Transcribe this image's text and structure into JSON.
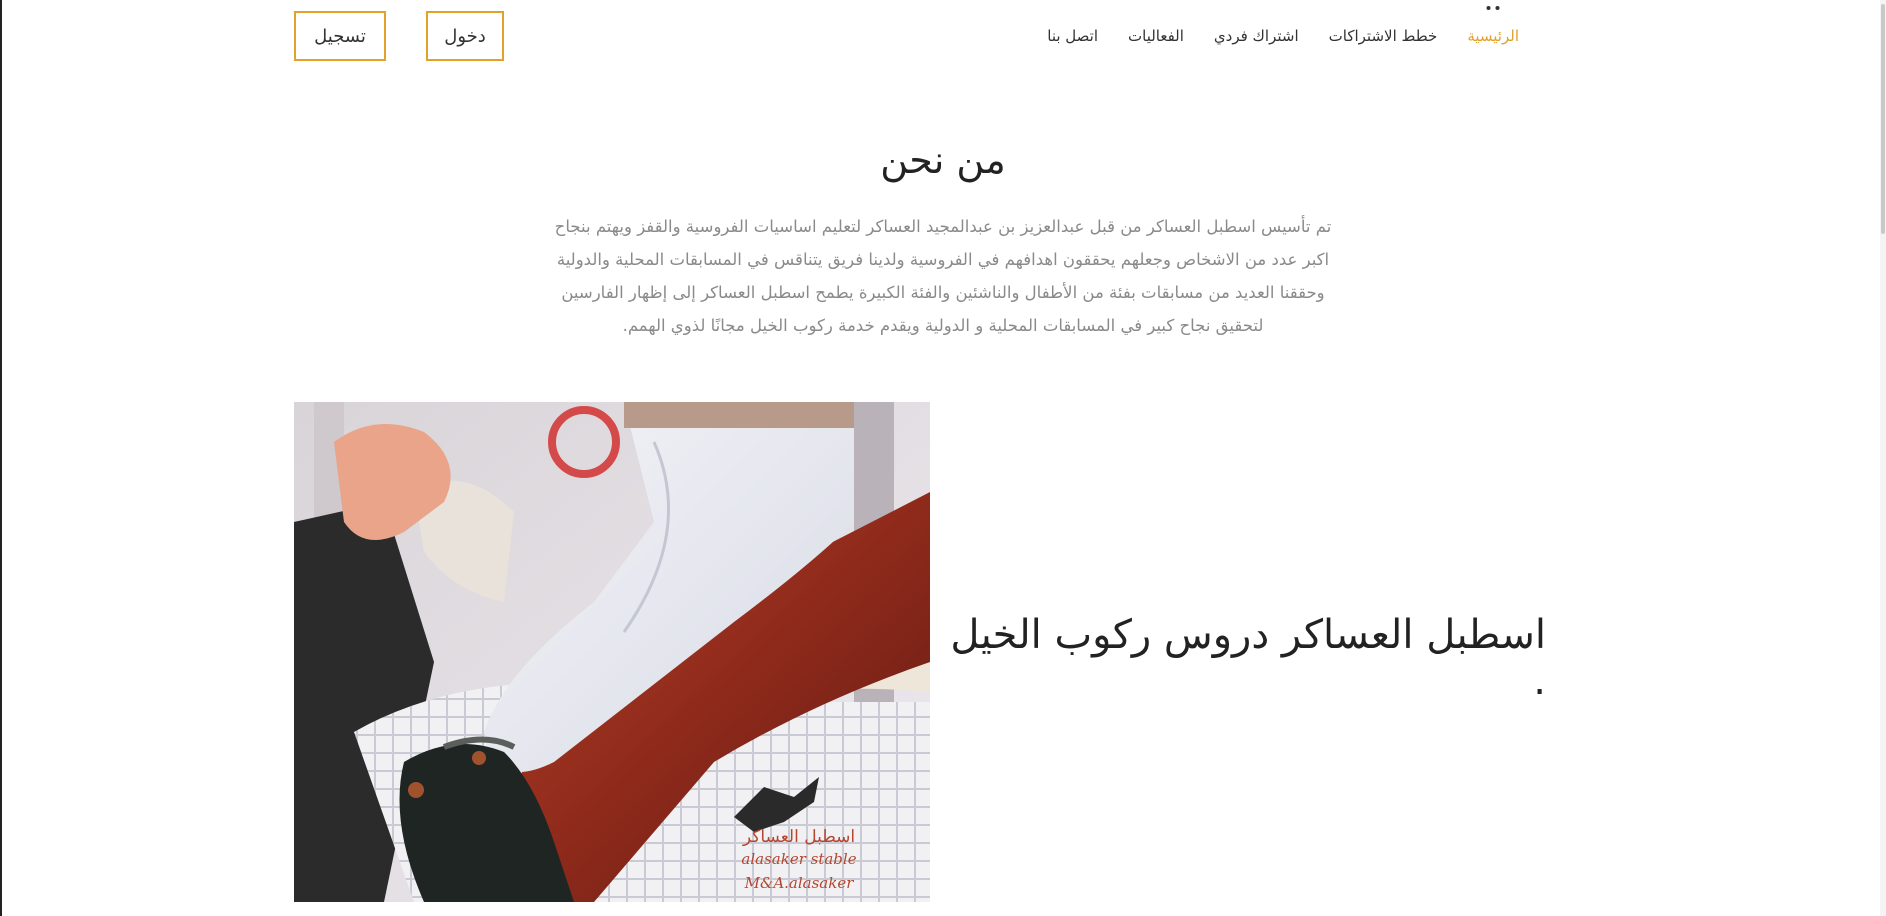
{
  "nav": {
    "items": [
      {
        "label": "الرئيسية",
        "active": true
      },
      {
        "label": "خطط الاشتراكات",
        "active": false
      },
      {
        "label": "اشتراك فردي",
        "active": false
      },
      {
        "label": "الفعاليات",
        "active": false
      },
      {
        "label": "اتصل بنا",
        "active": false
      }
    ],
    "login_label": "دخول",
    "register_label": "تسجيل"
  },
  "about": {
    "title": "من نحن",
    "lines": [
      "تم تأسيس اسطبل العساكر من قبل عبدالعزيز بن عبدالمجيد العساكر لتعليم اساسيات الفروسية والقفز ويهتم بنجاح",
      "اكبر عدد من الاشخاص وجعلهم يحققون اهدافهم في الفروسية ولدينا فريق يتناقس في المسابقات المحلية والدولية",
      "وحققنا العديد من مسابقات بفئة من الأطفال والناشئين والفئة الكبيرة يطمح اسطبل العساكر إلى إظهار الفارسين",
      "لتحقيق نجاح كبير في المسابقات المحلية و الدولية ويقدم خدمة ركوب الخيل مجانًا لذوي الهمم."
    ]
  },
  "feature": {
    "heading": "اسطبل العساكر دروس ركوب الخيل .",
    "image_text": {
      "line1": "اسطبل العساكر",
      "line2": "alasaker stable",
      "line3": "M&A.alasaker"
    }
  },
  "colors": {
    "accent": "#e1a12b",
    "text": "#333333",
    "muted": "#8a8a8a"
  }
}
